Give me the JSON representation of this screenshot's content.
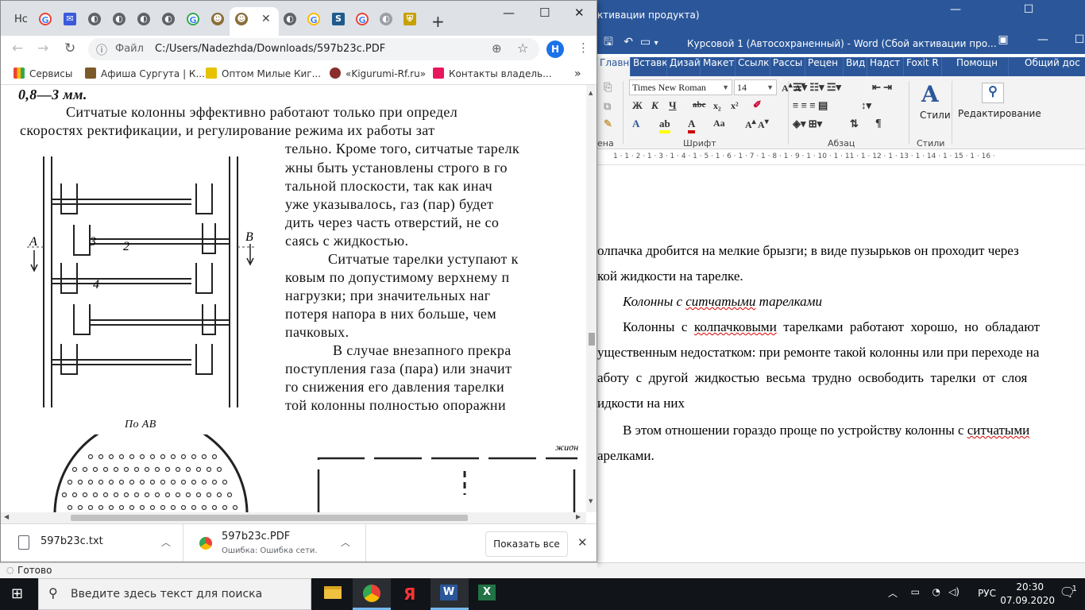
{
  "chrome": {
    "tab_first_label": "Нс",
    "address_site_label": "Файл",
    "address_url": "C:/Users/Nadezhda/Downloads/597b23c.PDF",
    "avatar_letter": "H",
    "bookmarks": [
      "Сервисы",
      "Афиша Сургута | К...",
      "Оптом Милые Киг...",
      "«Kigurumi-Rf.ru»",
      "Контакты владель..."
    ],
    "pdf": {
      "lines": [
        "0,8—3 мм.",
        "Ситчатые  колонны эффективно работают только при  определ",
        "скоростях  ректификации, и регулирование режима их работы  зат",
        "тельно. Кроме того, ситчатые тарелк",
        "жны быть установлены  строго в го",
        "тальной  плоскости, так как  инач",
        "уже  указывалось, газ (пар) будет",
        "дить  через  часть  отверстий,  не  со",
        "саясь  с  жидкостью.",
        "Ситчатые  тарелки  уступают  к",
        "ковым  по  допустимому  верхнему  п",
        "нагрузки;  при  значительных   наг",
        "потеря  напора  в  них  больше,   чем",
        "пачковых.",
        "В  случае  внезапного   прекра",
        "поступления  газа (пара) или значит",
        "го снижения  его давления тарелки",
        "той  колонны  полностью   опоражни"
      ],
      "fig_labels": {
        "a": "А",
        "b": "В",
        "n2": "2",
        "n3": "3",
        "n4": "4",
        "section": "По АВ",
        "liquid": "жидн"
      }
    },
    "downloads": [
      {
        "name": "597b23c.txt",
        "sub": ""
      },
      {
        "name": "597b23c.PDF",
        "sub": "Ошибка: Ошибка сети."
      }
    ],
    "show_all": "Показать все",
    "status": "Готово"
  },
  "word": {
    "title_partial": "ктивации продукта)",
    "doc_title": "Курсовой 1 (Автосохраненный) - Word (Сбой активации про...",
    "tabs": [
      "Главна",
      "Вставк",
      "Дизай",
      "Макет",
      "Ссылк",
      "Рассы",
      "Рецен",
      "Вид",
      "Надст",
      "Foxit R",
      "Помощн",
      "Общий дос"
    ],
    "font_name": "Times New Roman",
    "font_size": "14",
    "groups": [
      "ена",
      "Шрифт",
      "Абзац",
      "Стили"
    ],
    "styles_label": "Стили",
    "editing_label": "Редактирование",
    "ruler": "1 · 1 · 2 · 1 · 3 · 1 · 4 · 1 · 5 · 1 · 6 · 1 · 7 · 1 · 8 · 1 · 9 · 1 · 10 · 1 · 11 · 1 · 12 · 1 · 13 · 1 · 14 · 1 · 15 · 1 · 16 ·",
    "para": {
      "l1": "олпачка дробится на мелкие брызги; в виде пузырьков он проходит через",
      "l2": "кой жидкости на тарелке.",
      "heading_pre": "Колонны с ",
      "heading_sq": "ситчатыми",
      "heading_post": " тарелками",
      "l4_pre": "Колонны  с  ",
      "l4_sq": "колпачковыми",
      "l4_post": "  тарелками  работают  хорошо,  но  обладают",
      "l5": "ущественным недостатком: при ремонте такой колонны или при переходе на",
      "l6": "аботу  с  другой  жидкостью  весьма  трудно  освободить  тарелки  от  слоя",
      "l7": "идкости на них",
      "l8_pre": "В этом отношении гораздо проще по устройству колонны с ",
      "l8_sq": "ситчатыми",
      "l9": "арелками."
    }
  },
  "taskbar": {
    "search_placeholder": "Введите здесь текст для поиска",
    "lang": "РУС",
    "time": "20:30",
    "date": "07.09.2020",
    "notif_count": "1"
  }
}
